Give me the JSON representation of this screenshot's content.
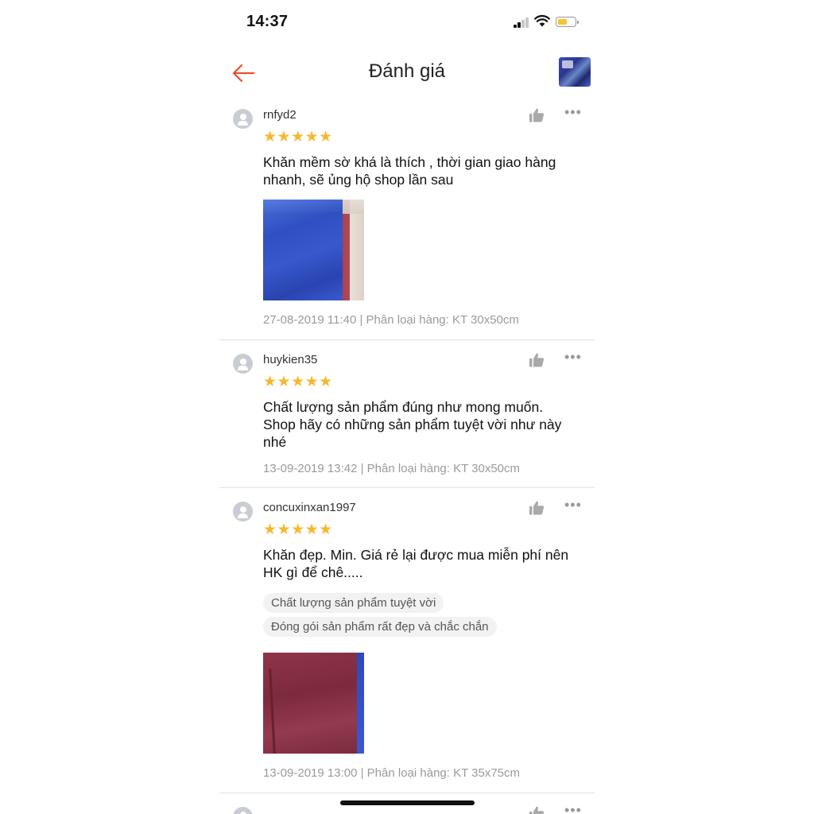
{
  "status": {
    "time": "14:37"
  },
  "header": {
    "title": "Đánh giá",
    "back_icon": "arrow-left-icon",
    "accent": "#ee4d2d"
  },
  "reviews": [
    {
      "username": "rnfyd2",
      "stars": "★★★★★",
      "rating": 5,
      "comment_lines": [
        "Khăn mềm sờ khá là thích , thời gian giao hàng",
        "nhanh, sẽ ủng hộ shop lần sau"
      ],
      "meta": "27-08-2019 11:40 | Phân loại hàng: KT 30x50cm"
    },
    {
      "username": "huykien35",
      "stars": "★★★★★",
      "rating": 5,
      "comment_lines": [
        "Chất lượng sản phẩm đúng như mong muốn.",
        "Shop hãy có những sản phẩm tuyệt vời như này",
        "nhé"
      ],
      "meta": "13-09-2019 13:42 | Phân loại hàng: KT 30x50cm"
    },
    {
      "username": "concuxinxan1997",
      "stars": "★★★★★",
      "rating": 5,
      "comment_lines": [
        "Khăn đẹp. Min. Giá rẻ lại được mua miễn phí nên",
        "HK gì để chê....."
      ],
      "tags": [
        "Chất lượng sản phẩm tuyệt vời",
        "Đóng gói sản phẩm rất đẹp và chắc chắn"
      ],
      "meta": "13-09-2019 13:00 | Phân loại hàng: KT 35x75cm"
    }
  ],
  "colors": {
    "star": "#f5b82e",
    "meta_text": "#9a9a9a",
    "divider": "#e2e2e2"
  }
}
